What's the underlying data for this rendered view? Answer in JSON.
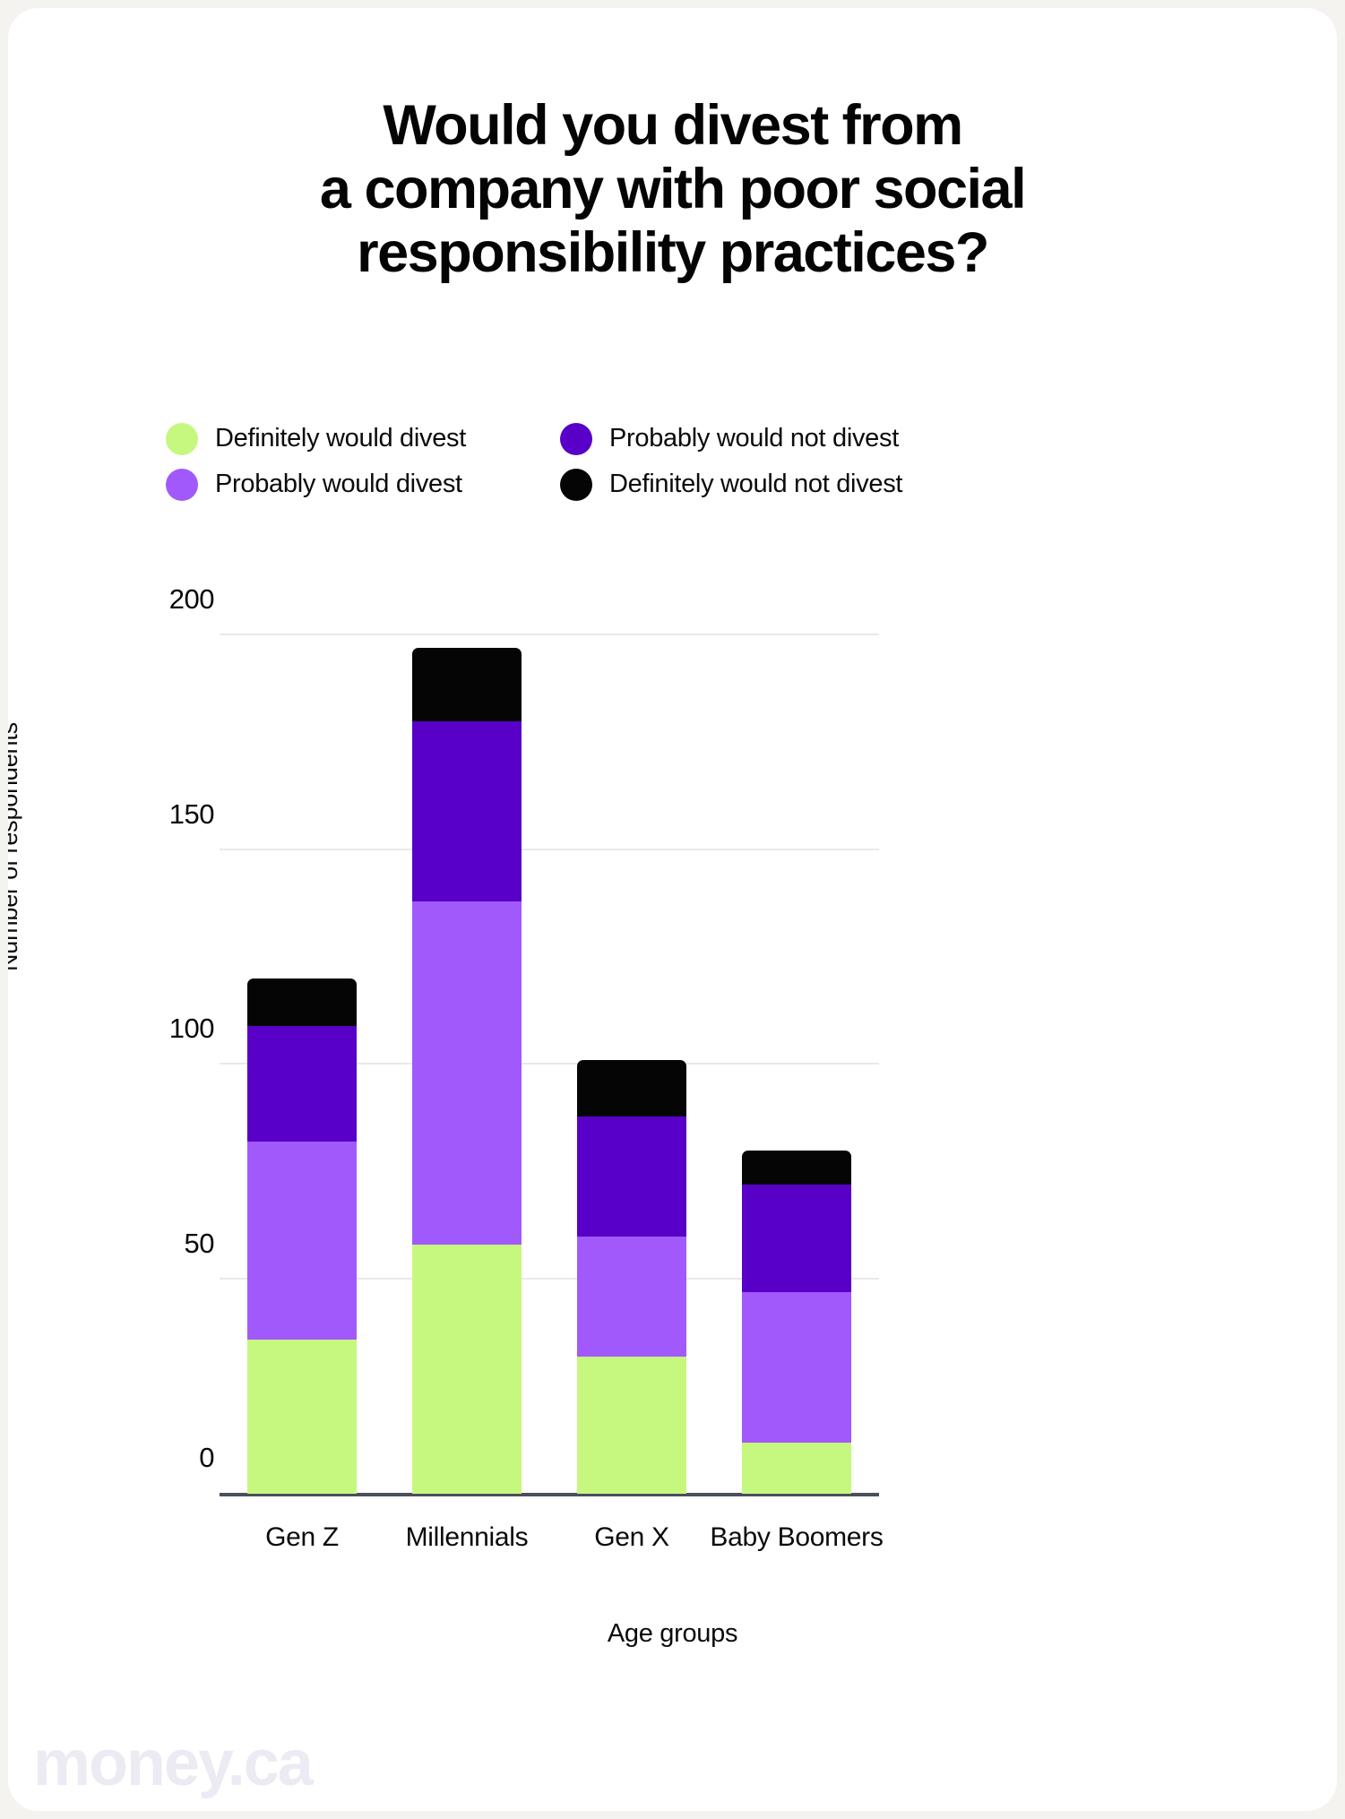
{
  "title": {
    "line1": "Would you divest from",
    "line2": "a company with poor social",
    "line3": "responsibility practices?"
  },
  "legend": {
    "items": [
      {
        "label": "Definitely would divest",
        "color": "#c6f87f",
        "icon": "legend-dot"
      },
      {
        "label": "Probably would not divest",
        "color": "#5800c8",
        "icon": "legend-dot"
      },
      {
        "label": "Probably would divest",
        "color": "#a259fb",
        "icon": "legend-dot"
      },
      {
        "label": "Definitely would not divest",
        "color": "#050505",
        "icon": "legend-dot"
      }
    ]
  },
  "watermark": "money.ca",
  "chart_data": {
    "type": "bar",
    "stacked": true,
    "title": "Would you divest from a company with poor social responsibility practices?",
    "xlabel": "Age groups",
    "ylabel": "Number of respondents",
    "categories": [
      "Gen Z",
      "Millennials",
      "Gen X",
      "Baby Boomers"
    ],
    "ylim": [
      0,
      200
    ],
    "yticks": [
      "0",
      "50",
      "100",
      "150",
      "200"
    ],
    "ytick_values": [
      0,
      50,
      100,
      150,
      200
    ],
    "grid": true,
    "legend_position": "top",
    "series": [
      {
        "name": "Definitely would divest",
        "color": "#c6f87f",
        "values": [
          36,
          58,
          32,
          12
        ]
      },
      {
        "name": "Probably would divest",
        "color": "#a259fb",
        "values": [
          46,
          80,
          28,
          35
        ]
      },
      {
        "name": "Probably would not divest",
        "color": "#5800c8",
        "values": [
          27,
          42,
          28,
          25
        ]
      },
      {
        "name": "Definitely would not divest",
        "color": "#050505",
        "values": [
          11,
          17,
          13,
          8
        ]
      }
    ],
    "totals": [
      120,
      197,
      101,
      80
    ]
  }
}
